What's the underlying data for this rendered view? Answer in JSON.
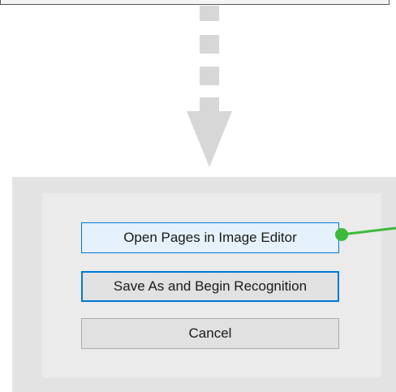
{
  "dialog": {
    "buttons": {
      "open_pages": "Open Pages in Image Editor",
      "save_as": "Save As and Begin Recognition",
      "cancel": "Cancel"
    }
  },
  "colors": {
    "arrow": "#d7d7d7",
    "accent_blue": "#0078d7",
    "callout_green": "#3dba3c"
  },
  "icons": {
    "flow_arrow": "down-arrow-icon",
    "callout_marker": "callout-dot-icon"
  }
}
